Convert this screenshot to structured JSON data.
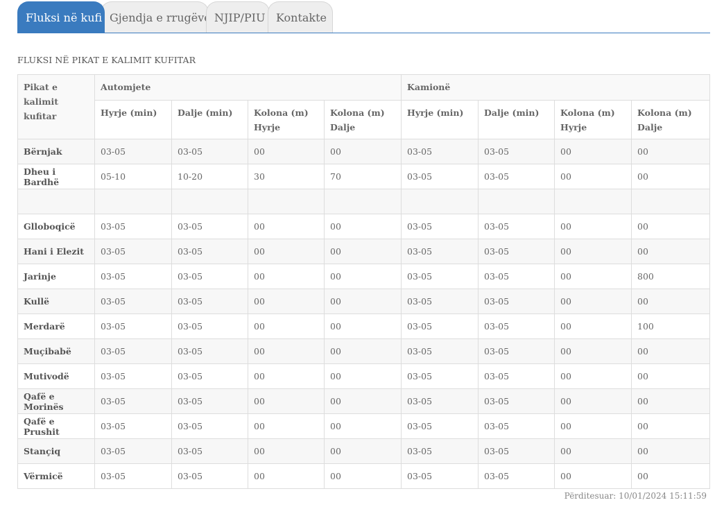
{
  "tabs": [
    {
      "label": "Fluksi në kufi",
      "active": true
    },
    {
      "label": "Gjendja e rrugëve",
      "active": false
    },
    {
      "label": "NJIP/PIU",
      "active": false
    },
    {
      "label": "Kontakte",
      "active": false
    }
  ],
  "colors": {
    "accent": "#3a7bbf",
    "tab_inactive": "#eeeeee",
    "border": "#dddddd"
  },
  "section_title": "FLUKSI NË PIKAT E KALIMIT KUFITAR",
  "table": {
    "row_header": "Pikat e kalimit kufitar",
    "groups": [
      "Automjete",
      "Kamionë"
    ],
    "columns": [
      "Hyrje (min)",
      "Dalje (min)",
      "Kolona (m) Hyrje",
      "Kolona (m) Dalje",
      "Hyrje (min)",
      "Dalje (min)",
      "Kolona (m) Hyrje",
      "Kolona (m) Dalje"
    ],
    "rows": [
      {
        "name": "Bërnjak",
        "values": [
          "03-05",
          "03-05",
          "00",
          "00",
          "03-05",
          "03-05",
          "00",
          "00"
        ]
      },
      {
        "name": "Dheu i Bardhë",
        "values": [
          "05-10",
          "10-20",
          "30",
          "70",
          "03-05",
          "03-05",
          "00",
          "00"
        ]
      },
      {
        "name": "",
        "values": [
          "",
          "",
          "",
          "",
          "",
          "",
          "",
          ""
        ]
      },
      {
        "name": "Glloboqicë",
        "values": [
          "03-05",
          "03-05",
          "00",
          "00",
          "03-05",
          "03-05",
          "00",
          "00"
        ]
      },
      {
        "name": "Hani i Elezit",
        "values": [
          "03-05",
          "03-05",
          "00",
          "00",
          "03-05",
          "03-05",
          "00",
          "00"
        ]
      },
      {
        "name": "Jarinje",
        "values": [
          "03-05",
          "03-05",
          "00",
          "00",
          "03-05",
          "03-05",
          "00",
          "800"
        ]
      },
      {
        "name": "Kullë",
        "values": [
          "03-05",
          "03-05",
          "00",
          "00",
          "03-05",
          "03-05",
          "00",
          "00"
        ]
      },
      {
        "name": "Merdarë",
        "values": [
          "03-05",
          "03-05",
          "00",
          "00",
          "03-05",
          "03-05",
          "00",
          "100"
        ]
      },
      {
        "name": "Muçibabë",
        "values": [
          "03-05",
          "03-05",
          "00",
          "00",
          "03-05",
          "03-05",
          "00",
          "00"
        ]
      },
      {
        "name": "Mutivodë",
        "values": [
          "03-05",
          "03-05",
          "00",
          "00",
          "03-05",
          "03-05",
          "00",
          "00"
        ]
      },
      {
        "name": "Qafë e Morinës",
        "values": [
          "03-05",
          "03-05",
          "00",
          "00",
          "03-05",
          "03-05",
          "00",
          "00"
        ]
      },
      {
        "name": "Qafë e Prushit",
        "values": [
          "03-05",
          "03-05",
          "00",
          "00",
          "03-05",
          "03-05",
          "00",
          "00"
        ]
      },
      {
        "name": "Stançiq",
        "values": [
          "03-05",
          "03-05",
          "00",
          "00",
          "03-05",
          "03-05",
          "00",
          "00"
        ]
      },
      {
        "name": "Vërmicë",
        "values": [
          "03-05",
          "03-05",
          "00",
          "00",
          "03-05",
          "03-05",
          "00",
          "00"
        ]
      }
    ]
  },
  "updated": "Përditesuar: 10/01/2024 15:11:59"
}
